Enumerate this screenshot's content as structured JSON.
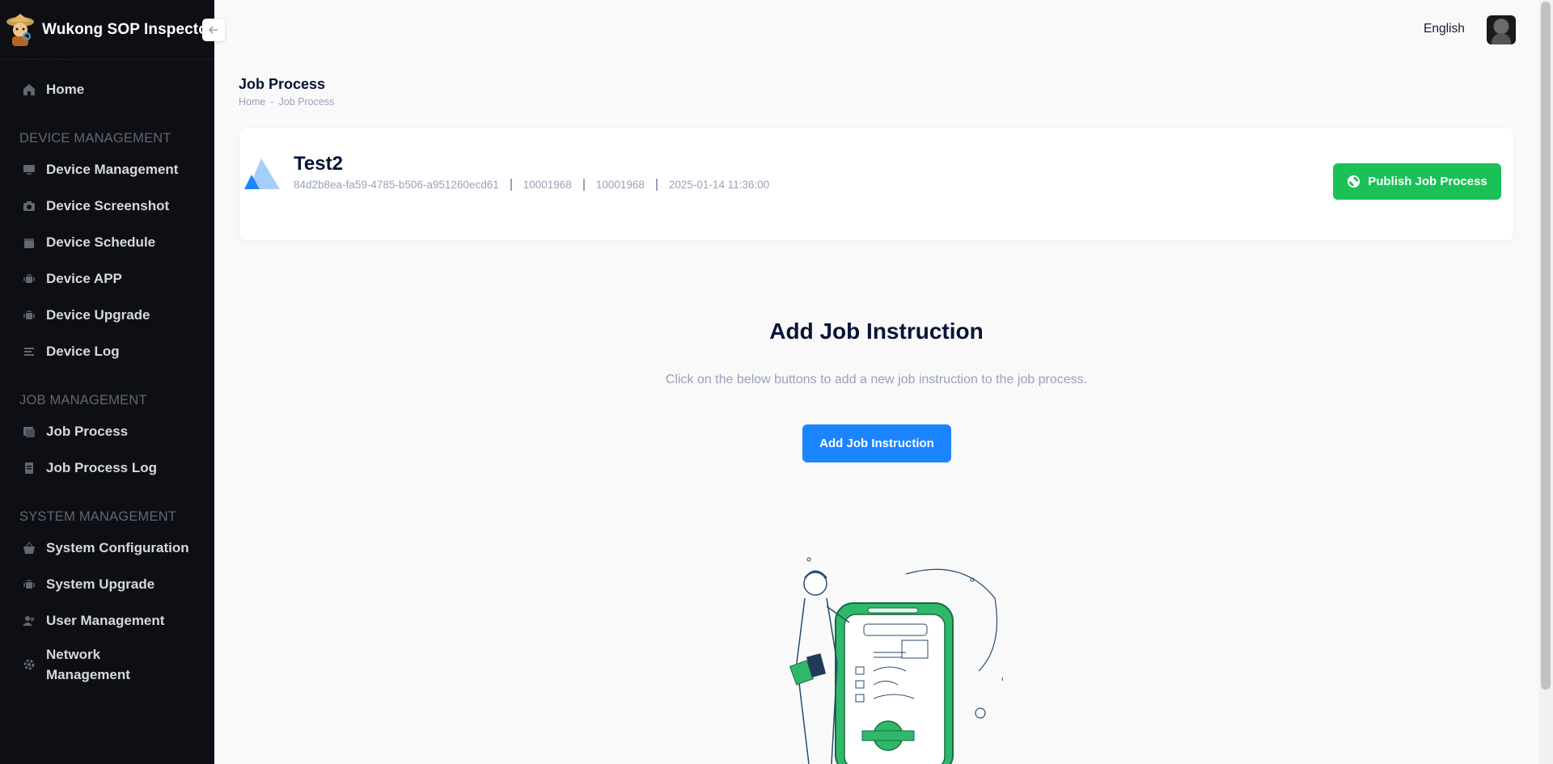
{
  "app": {
    "title": "Wukong SOP Inspector"
  },
  "sidebar": {
    "home": "Home",
    "sections": [
      {
        "title": "DEVICE MANAGEMENT",
        "items": [
          "Device Management",
          "Device Screenshot",
          "Device Schedule",
          "Device APP",
          "Device Upgrade",
          "Device Log"
        ]
      },
      {
        "title": "JOB MANAGEMENT",
        "items": [
          "Job Process",
          "Job Process Log"
        ]
      },
      {
        "title": "SYSTEM MANAGEMENT",
        "items": [
          "System Configuration",
          "System Upgrade",
          "User Management",
          "Network Management"
        ]
      }
    ],
    "icons": {
      "home": "home-icon",
      "device_management": "monitor-icon",
      "device_screenshot": "camera-icon",
      "device_schedule": "calendar-icon",
      "device_app": "android-icon",
      "device_upgrade": "android-icon",
      "device_log": "list-icon",
      "job_process": "picture-icon",
      "job_process_log": "document-icon",
      "system_configuration": "basket-icon",
      "system_upgrade": "android-icon",
      "user_management": "users-icon",
      "network_management": "gear-icon"
    }
  },
  "header": {
    "language": "English"
  },
  "page": {
    "title": "Job Process",
    "breadcrumb": {
      "home": "Home",
      "separator": "-",
      "current": "Job Process"
    }
  },
  "job": {
    "name": "Test2",
    "id": "84d2b8ea-fa59-4785-b506-a951260ecd61",
    "field2": "10001968",
    "field3": "10001968",
    "timestamp": "2025-01-14 11:36:00",
    "publish_label": "Publish Job Process"
  },
  "empty_state": {
    "title": "Add Job Instruction",
    "description": "Click on the below buttons to add a new job instruction to the job process.",
    "button_label": "Add Job Instruction"
  },
  "colors": {
    "sidebar_bg": "#0e0f14",
    "publish_green": "#1bc157",
    "primary_blue": "#1b84ff",
    "page_bg": "#f9f9fa"
  }
}
